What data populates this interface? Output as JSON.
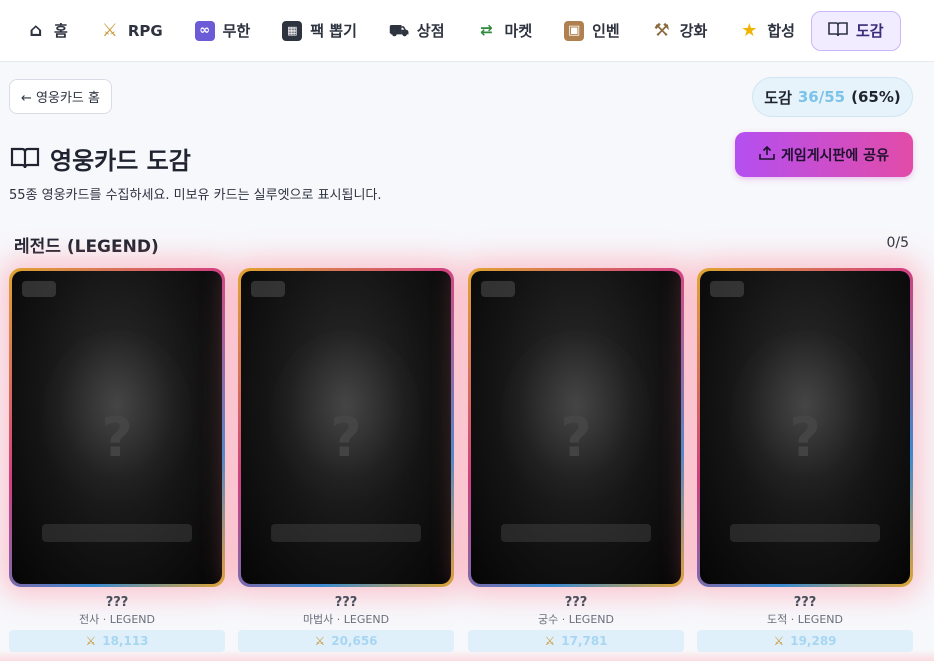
{
  "nav": {
    "items": [
      {
        "label": "홈",
        "icon": "home-icon",
        "glyph": "🏠"
      },
      {
        "label": "RPG",
        "icon": "crossed-swords-icon",
        "glyph": "⚔"
      },
      {
        "label": "무한",
        "icon": "infinity-icon",
        "glyph": "∞"
      },
      {
        "label": "팩 뽑기",
        "icon": "card-pack-icon",
        "glyph": "▦"
      },
      {
        "label": "상점",
        "icon": "cart-icon",
        "glyph": "🛒"
      },
      {
        "label": "마켓",
        "icon": "market-icon",
        "glyph": "💱"
      },
      {
        "label": "인벤",
        "icon": "box-icon",
        "glyph": "▣"
      },
      {
        "label": "강화",
        "icon": "hammer-icon",
        "glyph": "🔨"
      },
      {
        "label": "합성",
        "icon": "star-icon",
        "glyph": "★"
      },
      {
        "label": "도감",
        "icon": "book-icon",
        "glyph": "📖"
      }
    ],
    "active": "도감"
  },
  "back_button": {
    "label": "← 영웅카드 홈"
  },
  "progress": {
    "label": "도감",
    "count": "36/55",
    "percent": "(65%)"
  },
  "page": {
    "title": "영웅카드 도감",
    "subtitle": "55종 영웅카드를 수집하세요. 미보유 카드는 실루엣으로 표시됩니다."
  },
  "share_button": {
    "label": "게임게시판에 공유",
    "icon": "share-upload-icon"
  },
  "section": {
    "title": "레전드 (LEGEND)",
    "count": "0/5"
  },
  "cards": [
    {
      "name": "???",
      "meta": "전사 · LEGEND",
      "power": "18,113"
    },
    {
      "name": "???",
      "meta": "마법사 · LEGEND",
      "power": "20,656"
    },
    {
      "name": "???",
      "meta": "궁수 · LEGEND",
      "power": "17,781"
    },
    {
      "name": "???",
      "meta": "도적 · LEGEND",
      "power": "19,289"
    }
  ],
  "colors": {
    "accent_gradient_start": "#b44ff0",
    "accent_gradient_end": "#e24ca8",
    "progress_count": "#7cc3ea",
    "active_nav_bg": "#f1ecff"
  }
}
